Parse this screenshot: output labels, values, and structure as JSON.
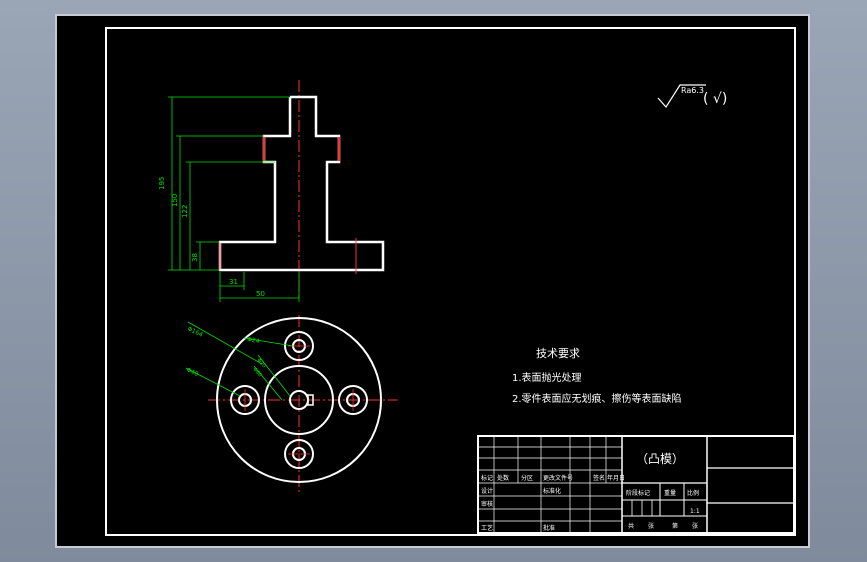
{
  "drawing": {
    "surface_finish": {
      "value": "Ra6.3",
      "suffix": "( √)"
    },
    "dimensions_front": {
      "overall_height": "195",
      "step_height": "150",
      "mid_height": "122",
      "base_thickness": "38",
      "half_base_offset": "31",
      "half_width": "50"
    },
    "dimensions_top": {
      "outer_dia": "Φ164",
      "hole_dia_small": "Φ24",
      "hole_dia_big": "Φ40",
      "center_hole": "Φ20",
      "inner_circle": "Φ80"
    },
    "tech_requirements": {
      "title": "技术要求",
      "item1": "1.表面抛光处理",
      "item2": "2.零件表面应无划痕、擦伤等表面缺陷"
    },
    "title_block": {
      "part_name": "（凸模）",
      "row_labels": [
        "标记",
        "处数",
        "分区",
        "更改文件号",
        "签名",
        "年月日"
      ],
      "design": "设计",
      "check": "审核",
      "process": "工艺",
      "standardize": "标准化",
      "approve": "批准",
      "stage_mark": "阶段标记",
      "weight": "重量",
      "scale": "比例",
      "scale_value": "1:1",
      "sheet_total": "共",
      "sheet_no": "张",
      "sheet_of": "第",
      "sheet_label": "张"
    }
  },
  "colors": {
    "outline": "#ffffff",
    "centerline": "#ff3030",
    "dimension": "#00e000",
    "text": "#ffffff"
  }
}
